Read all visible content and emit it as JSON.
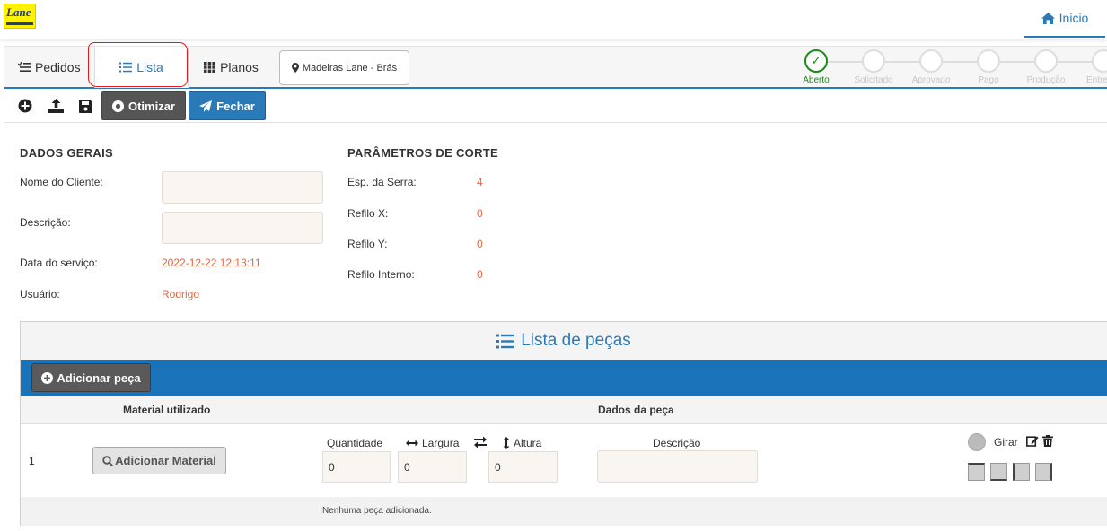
{
  "header": {
    "logo_text": "Lane",
    "home_label": "Inicio"
  },
  "tabs": [
    {
      "label": "Pedidos",
      "active": false
    },
    {
      "label": "Lista",
      "active": true
    },
    {
      "label": "Planos",
      "active": false
    }
  ],
  "store_button": "Madeiras Lane - Brás",
  "steps": [
    {
      "label": "Aberto",
      "done": true
    },
    {
      "label": "Solicitado",
      "done": false
    },
    {
      "label": "Aprovado",
      "done": false
    },
    {
      "label": "Pago",
      "done": false
    },
    {
      "label": "Produção",
      "done": false
    },
    {
      "label": "Entre",
      "done": false
    }
  ],
  "toolbar": {
    "otimizar_label": "Otimizar",
    "fechar_label": "Fechar"
  },
  "dados_gerais": {
    "title": "DADOS GERAIS",
    "nome_label": "Nome do Cliente:",
    "descricao_label": "Descrição:",
    "data_label": "Data do serviço:",
    "data_value": "2022-12-22 12:13:11",
    "usuario_label": "Usuário:",
    "usuario_value": "Rodrigo"
  },
  "parametros": {
    "title": "PARÂMETROS DE CORTE",
    "esp_label": "Esp. da Serra:",
    "esp_value": "4",
    "refilo_x_label": "Refilo X:",
    "refilo_x_value": "0",
    "refilo_y_label": "Refilo Y:",
    "refilo_y_value": "0",
    "refilo_interno_label": "Refilo Interno:",
    "refilo_interno_value": "0"
  },
  "lista": {
    "title": "Lista de peças",
    "add_peca_label": "Adicionar peça",
    "col_material": "Material utilizado",
    "col_dados": "Dados da peça",
    "row_number": "1",
    "add_material_label": "Adicionar Material",
    "quantidade_label": "Quantidade",
    "largura_label": "Largura",
    "altura_label": "Altura",
    "descricao_label": "Descrição",
    "quantidade_value": "0",
    "largura_value": "0",
    "altura_value": "0",
    "girar_label": "Girar",
    "empty_message": "Nenhuma peça adicionada."
  }
}
